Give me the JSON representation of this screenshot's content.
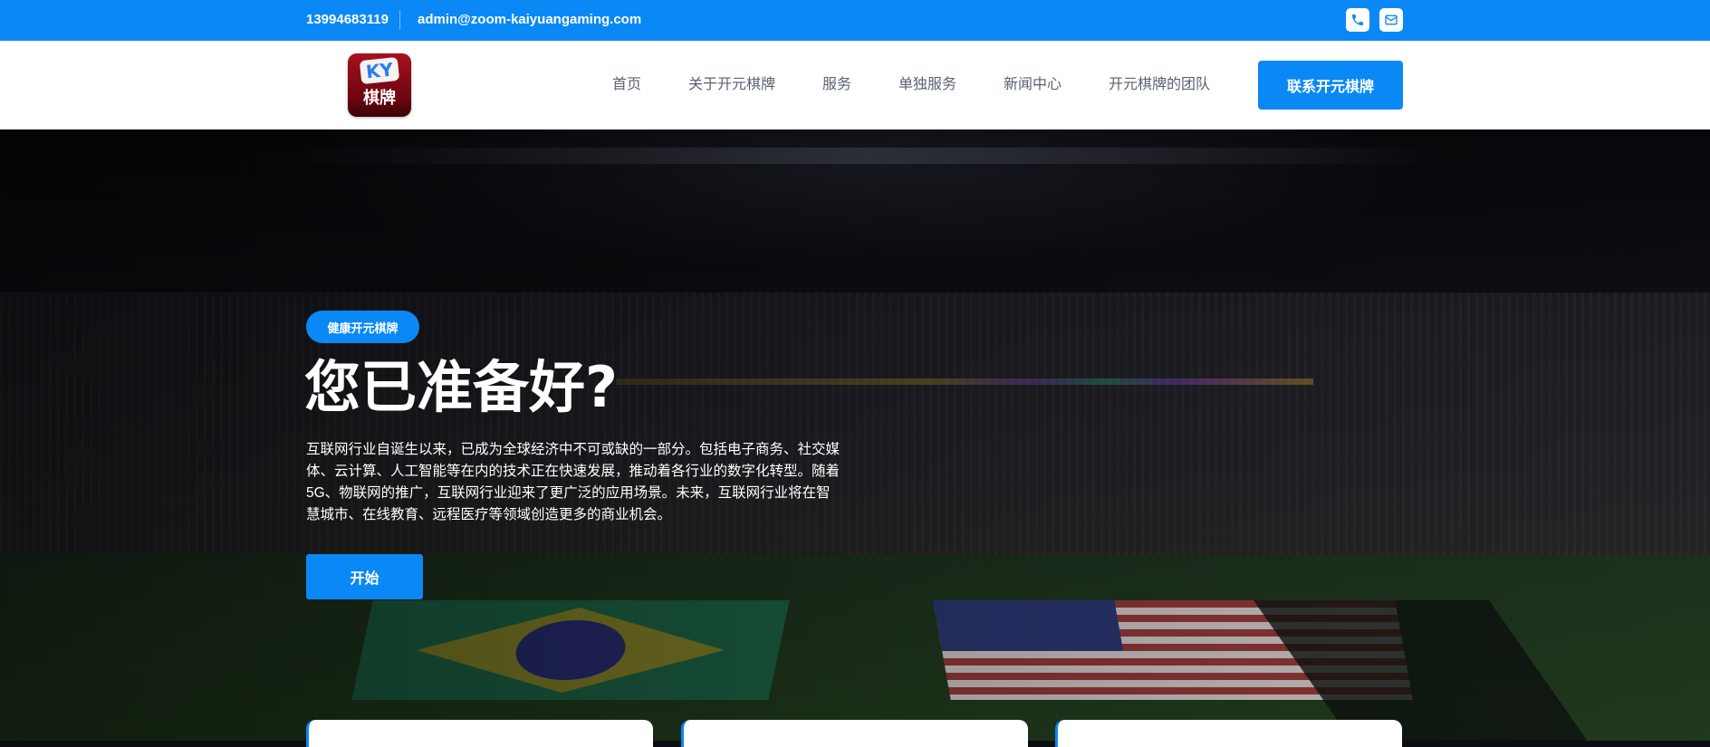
{
  "topbar": {
    "phone": "13994683119",
    "email": "admin@zoom-kaiyuangaming.com",
    "icons": [
      "phone-icon",
      "mail-icon"
    ]
  },
  "logo": {
    "mark": "KY",
    "name": "棋牌"
  },
  "nav": {
    "items": [
      "首页",
      "关于开元棋牌",
      "服务",
      "单独服务",
      "新闻中心",
      "开元棋牌的团队"
    ],
    "cta": "联系开元棋牌"
  },
  "hero": {
    "badge": "健康开元棋牌",
    "title": "您已准备好?",
    "description": "互联网行业自诞生以来，已成为全球经济中不可或缺的一部分。包括电子商务、社交媒体、云计算、人工智能等在内的技术正在快速发展，推动着各行业的数字化转型。随着5G、物联网的推广，互联网行业迎来了更广泛的应用场景。未来，互联网行业将在智慧城市、在线教育、远程医疗等领域创造更多的商业机会。",
    "button": "开始"
  },
  "colors": {
    "accent": "#0a88f5",
    "nav_text": "#5a6270"
  }
}
